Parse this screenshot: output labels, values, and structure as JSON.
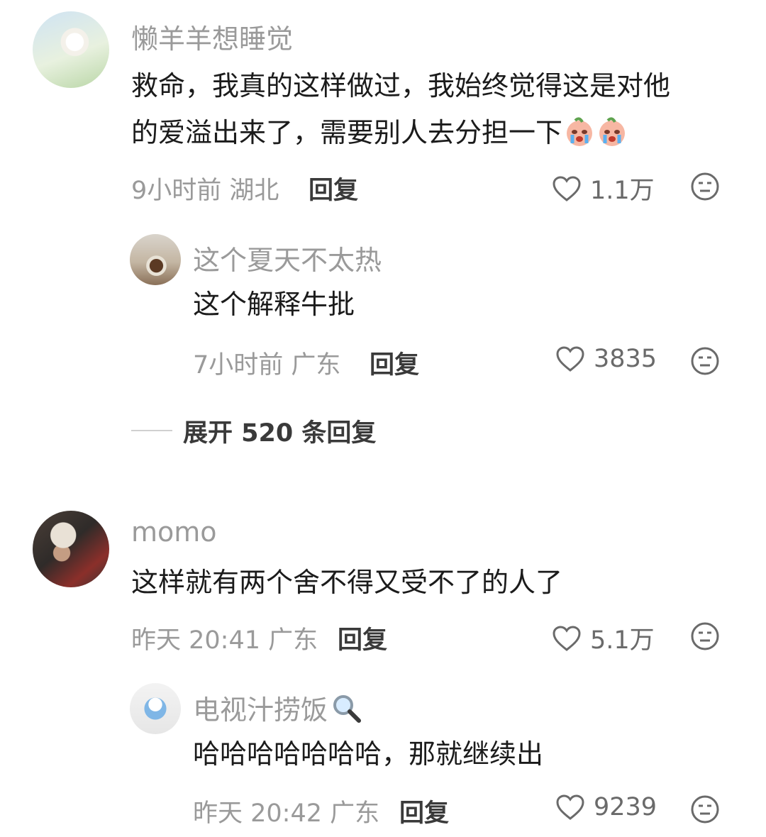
{
  "comments": [
    {
      "username": "懒羊羊想睡觉",
      "text_line1": "救命，我真的这样做过，我始终觉得这是对他",
      "text_line2": "的爱溢出来了，需要别人去分担一下",
      "emoji": "crying-face-emoji",
      "time": "9小时前 湖北",
      "reply_label": "回复",
      "likes": "1.1万",
      "reply": {
        "username": "这个夏天不太热",
        "text": "这个解释牛批",
        "time": "7小时前 广东",
        "reply_label": "回复",
        "likes": "3835"
      },
      "expand_label": "展开 520 条回复"
    },
    {
      "username": "momo",
      "text": "这样就有两个舍不得又受不了的人了",
      "time": "昨天 20:41 广东",
      "reply_label": "回复",
      "likes": "5.1万",
      "reply": {
        "username": "电视汁捞饭",
        "username_icon": "magnifier-emoji",
        "text": "哈哈哈哈哈哈哈，那就继续出",
        "time": "昨天 20:42 广东",
        "reply_label": "回复",
        "likes": "9239"
      }
    }
  ],
  "colors": {
    "username": "#9a9a9a",
    "text": "#1b1b1b",
    "meta": "#9a9a9a",
    "reply": "#3a3a3a"
  }
}
